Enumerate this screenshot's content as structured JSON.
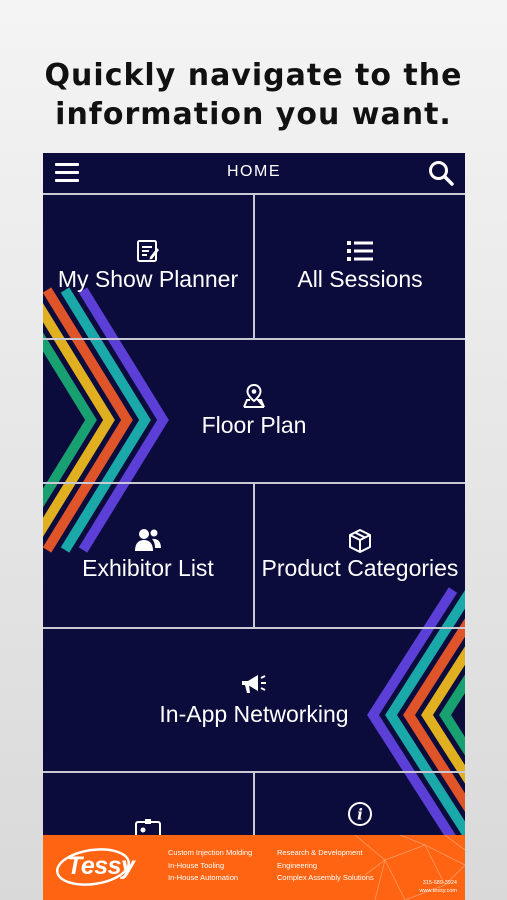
{
  "headline": {
    "line1": "Quickly navigate to the",
    "line2": "information you want."
  },
  "topbar": {
    "title": "HOME",
    "menu_icon": "hamburger-menu-icon",
    "search_icon": "search-icon"
  },
  "tiles": [
    {
      "label": "My Show Planner",
      "icon": "planner-icon"
    },
    {
      "label": "All Sessions",
      "icon": "list-icon"
    },
    {
      "label": "Floor Plan",
      "icon": "map-pin-icon"
    },
    {
      "label": "Exhibitor List",
      "icon": "people-icon"
    },
    {
      "label": "Product Categories",
      "icon": "cube-icon"
    },
    {
      "label": "In-App Networking",
      "icon": "megaphone-icon"
    },
    {
      "label": "",
      "icon": "id-badge-icon"
    },
    {
      "label": "",
      "icon": "info-icon"
    }
  ],
  "banner": {
    "logo": "Tessy",
    "services_col1": [
      "Custom Injection Molding",
      "In-House Tooling",
      "In-House Automation"
    ],
    "services_col2": [
      "Research & Development",
      "Engineering",
      "Complex Assembly Solutions"
    ],
    "phone": "315-689-3924",
    "website": "www.tessy.com"
  },
  "colors": {
    "app_background": "#0b0b3c",
    "divider": "#c9c9d6",
    "banner": "#ff6412",
    "chevron_purple": "#5b3fd6",
    "chevron_teal": "#1aa8a8",
    "chevron_orange": "#e0542a",
    "chevron_yellow": "#e0b020",
    "chevron_green": "#18a070"
  }
}
